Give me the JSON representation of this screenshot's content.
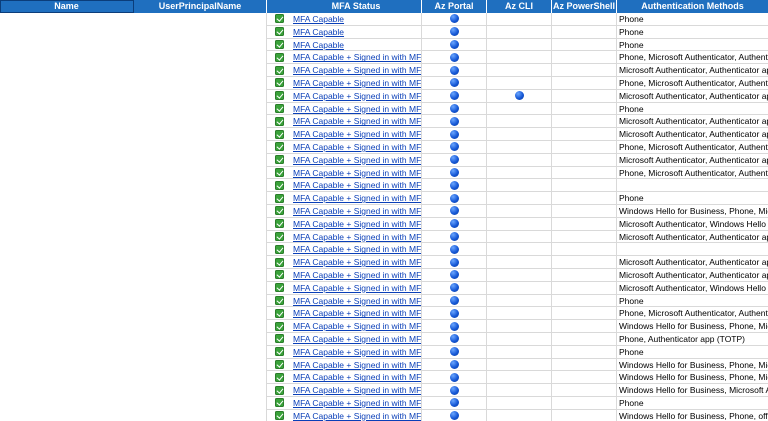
{
  "header": {
    "name": "Name",
    "upn": "UserPrincipalName",
    "mfa_status": "MFA Status",
    "az_portal": "Az Portal",
    "az_cli": "Az CLI",
    "az_powershell": "Az PowerShell",
    "auth_methods": "Authentication Methods"
  },
  "icons": {
    "check": "check-icon",
    "dot": "blue-dot-icon"
  },
  "colors": {
    "header_bg": "#1f6fbf",
    "link": "#0a3fb8",
    "check_green": "#3aa23a",
    "dot_blue": "#1658d6"
  },
  "rows": [
    {
      "mfa": "MFA Capable",
      "portal": true,
      "cli": false,
      "auth": "Phone"
    },
    {
      "mfa": "MFA Capable",
      "portal": true,
      "cli": false,
      "auth": "Phone"
    },
    {
      "mfa": "MFA Capable",
      "portal": true,
      "cli": false,
      "auth": "Phone"
    },
    {
      "mfa": "MFA Capable + Signed in with MFA",
      "portal": true,
      "cli": false,
      "auth": "Phone, Microsoft Authenticator, Authenti"
    },
    {
      "mfa": "MFA Capable + Signed in with MFA",
      "portal": true,
      "cli": false,
      "auth": "Microsoft Authenticator, Authenticator ap"
    },
    {
      "mfa": "MFA Capable + Signed in with MFA",
      "portal": true,
      "cli": false,
      "auth": "Phone, Microsoft Authenticator, Authenti"
    },
    {
      "mfa": "MFA Capable + Signed in with MFA",
      "portal": true,
      "cli": true,
      "auth": "Microsoft Authenticator, Authenticator ap"
    },
    {
      "mfa": "MFA Capable + Signed in with MFA",
      "portal": true,
      "cli": false,
      "auth": "Phone"
    },
    {
      "mfa": "MFA Capable + Signed in with MFA",
      "portal": true,
      "cli": false,
      "auth": "Microsoft Authenticator, Authenticator ap"
    },
    {
      "mfa": "MFA Capable + Signed in with MFA",
      "portal": true,
      "cli": false,
      "auth": "Microsoft Authenticator, Authenticator ap"
    },
    {
      "mfa": "MFA Capable + Signed in with MFA",
      "portal": true,
      "cli": false,
      "auth": "Phone, Microsoft Authenticator, Authenti"
    },
    {
      "mfa": "MFA Capable + Signed in with MFA",
      "portal": true,
      "cli": false,
      "auth": "Microsoft Authenticator, Authenticator ap"
    },
    {
      "mfa": "MFA Capable + Signed in with MFA",
      "portal": true,
      "cli": false,
      "auth": "Phone, Microsoft Authenticator, Authenti"
    },
    {
      "mfa": "MFA Capable + Signed in with MFA",
      "portal": true,
      "cli": false,
      "auth": ""
    },
    {
      "mfa": "MFA Capable + Signed in with MFA",
      "portal": true,
      "cli": false,
      "auth": "Phone"
    },
    {
      "mfa": "MFA Capable + Signed in with MFA",
      "portal": true,
      "cli": false,
      "auth": "Windows Hello for Business, Phone, Micro"
    },
    {
      "mfa": "MFA Capable + Signed in with MFA",
      "portal": true,
      "cli": false,
      "auth": "Microsoft Authenticator, Windows Hello f"
    },
    {
      "mfa": "MFA Capable + Signed in with MFA",
      "portal": true,
      "cli": false,
      "auth": "Microsoft Authenticator, Authenticator ap"
    },
    {
      "mfa": "MFA Capable + Signed in with MFA",
      "portal": true,
      "cli": false,
      "auth": ""
    },
    {
      "mfa": "MFA Capable + Signed in with MFA",
      "portal": true,
      "cli": false,
      "auth": "Microsoft Authenticator, Authenticator ap"
    },
    {
      "mfa": "MFA Capable + Signed in with MFA",
      "portal": true,
      "cli": false,
      "auth": "Microsoft Authenticator, Authenticator ap"
    },
    {
      "mfa": "MFA Capable + Signed in with MFA",
      "portal": true,
      "cli": false,
      "auth": "Microsoft Authenticator, Windows Hello f"
    },
    {
      "mfa": "MFA Capable + Signed in with MFA",
      "portal": true,
      "cli": false,
      "auth": "Phone"
    },
    {
      "mfa": "MFA Capable + Signed in with MFA",
      "portal": true,
      "cli": false,
      "auth": "Phone, Microsoft Authenticator, Authenti"
    },
    {
      "mfa": "MFA Capable + Signed in with MFA",
      "portal": true,
      "cli": false,
      "auth": "Windows Hello for Business, Phone, Micro"
    },
    {
      "mfa": "MFA Capable + Signed in with MFA",
      "portal": true,
      "cli": false,
      "auth": "Phone, Authenticator app (TOTP)"
    },
    {
      "mfa": "MFA Capable + Signed in with MFA",
      "portal": true,
      "cli": false,
      "auth": "Phone"
    },
    {
      "mfa": "MFA Capable + Signed in with MFA",
      "portal": true,
      "cli": false,
      "auth": "Windows Hello for Business, Phone, Micro"
    },
    {
      "mfa": "MFA Capable + Signed in with MFA",
      "portal": true,
      "cli": false,
      "auth": "Windows Hello for Business, Phone, Micro"
    },
    {
      "mfa": "MFA Capable + Signed in with MFA",
      "portal": true,
      "cli": false,
      "auth": "Windows Hello for Business, Microsoft Aut"
    },
    {
      "mfa": "MFA Capable + Signed in with MFA",
      "portal": true,
      "cli": false,
      "auth": "Phone"
    },
    {
      "mfa": "MFA Capable + Signed in with MFA",
      "portal": true,
      "cli": false,
      "auth": "Windows Hello for Business, Phone, officeF"
    }
  ]
}
